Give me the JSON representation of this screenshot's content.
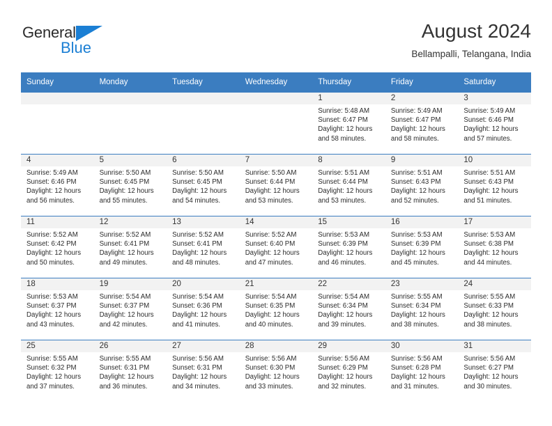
{
  "brand": {
    "line1": "General",
    "line2": "Blue",
    "triangle_color": "#1b7fd4",
    "text_color": "#2b2b2b"
  },
  "header": {
    "title": "August 2024",
    "subtitle": "Bellampalli, Telangana, India"
  },
  "theme": {
    "header_blue": "#3b7dc0",
    "band_gray": "#f2f2f2",
    "text": "#2b2b2b"
  },
  "weekdays": [
    "Sunday",
    "Monday",
    "Tuesday",
    "Wednesday",
    "Thursday",
    "Friday",
    "Saturday"
  ],
  "labels": {
    "sunrise": "Sunrise:",
    "sunset": "Sunset:",
    "daylight": "Daylight:"
  },
  "weeks": [
    [
      {
        "day": "",
        "sunrise": "",
        "sunset": "",
        "daylight_line1": "",
        "daylight_line2": ""
      },
      {
        "day": "",
        "sunrise": "",
        "sunset": "",
        "daylight_line1": "",
        "daylight_line2": ""
      },
      {
        "day": "",
        "sunrise": "",
        "sunset": "",
        "daylight_line1": "",
        "daylight_line2": ""
      },
      {
        "day": "",
        "sunrise": "",
        "sunset": "",
        "daylight_line1": "",
        "daylight_line2": ""
      },
      {
        "day": "1",
        "sunrise": "Sunrise: 5:48 AM",
        "sunset": "Sunset: 6:47 PM",
        "daylight_line1": "Daylight: 12 hours",
        "daylight_line2": "and 58 minutes."
      },
      {
        "day": "2",
        "sunrise": "Sunrise: 5:49 AM",
        "sunset": "Sunset: 6:47 PM",
        "daylight_line1": "Daylight: 12 hours",
        "daylight_line2": "and 58 minutes."
      },
      {
        "day": "3",
        "sunrise": "Sunrise: 5:49 AM",
        "sunset": "Sunset: 6:46 PM",
        "daylight_line1": "Daylight: 12 hours",
        "daylight_line2": "and 57 minutes."
      }
    ],
    [
      {
        "day": "4",
        "sunrise": "Sunrise: 5:49 AM",
        "sunset": "Sunset: 6:46 PM",
        "daylight_line1": "Daylight: 12 hours",
        "daylight_line2": "and 56 minutes."
      },
      {
        "day": "5",
        "sunrise": "Sunrise: 5:50 AM",
        "sunset": "Sunset: 6:45 PM",
        "daylight_line1": "Daylight: 12 hours",
        "daylight_line2": "and 55 minutes."
      },
      {
        "day": "6",
        "sunrise": "Sunrise: 5:50 AM",
        "sunset": "Sunset: 6:45 PM",
        "daylight_line1": "Daylight: 12 hours",
        "daylight_line2": "and 54 minutes."
      },
      {
        "day": "7",
        "sunrise": "Sunrise: 5:50 AM",
        "sunset": "Sunset: 6:44 PM",
        "daylight_line1": "Daylight: 12 hours",
        "daylight_line2": "and 53 minutes."
      },
      {
        "day": "8",
        "sunrise": "Sunrise: 5:51 AM",
        "sunset": "Sunset: 6:44 PM",
        "daylight_line1": "Daylight: 12 hours",
        "daylight_line2": "and 53 minutes."
      },
      {
        "day": "9",
        "sunrise": "Sunrise: 5:51 AM",
        "sunset": "Sunset: 6:43 PM",
        "daylight_line1": "Daylight: 12 hours",
        "daylight_line2": "and 52 minutes."
      },
      {
        "day": "10",
        "sunrise": "Sunrise: 5:51 AM",
        "sunset": "Sunset: 6:43 PM",
        "daylight_line1": "Daylight: 12 hours",
        "daylight_line2": "and 51 minutes."
      }
    ],
    [
      {
        "day": "11",
        "sunrise": "Sunrise: 5:52 AM",
        "sunset": "Sunset: 6:42 PM",
        "daylight_line1": "Daylight: 12 hours",
        "daylight_line2": "and 50 minutes."
      },
      {
        "day": "12",
        "sunrise": "Sunrise: 5:52 AM",
        "sunset": "Sunset: 6:41 PM",
        "daylight_line1": "Daylight: 12 hours",
        "daylight_line2": "and 49 minutes."
      },
      {
        "day": "13",
        "sunrise": "Sunrise: 5:52 AM",
        "sunset": "Sunset: 6:41 PM",
        "daylight_line1": "Daylight: 12 hours",
        "daylight_line2": "and 48 minutes."
      },
      {
        "day": "14",
        "sunrise": "Sunrise: 5:52 AM",
        "sunset": "Sunset: 6:40 PM",
        "daylight_line1": "Daylight: 12 hours",
        "daylight_line2": "and 47 minutes."
      },
      {
        "day": "15",
        "sunrise": "Sunrise: 5:53 AM",
        "sunset": "Sunset: 6:39 PM",
        "daylight_line1": "Daylight: 12 hours",
        "daylight_line2": "and 46 minutes."
      },
      {
        "day": "16",
        "sunrise": "Sunrise: 5:53 AM",
        "sunset": "Sunset: 6:39 PM",
        "daylight_line1": "Daylight: 12 hours",
        "daylight_line2": "and 45 minutes."
      },
      {
        "day": "17",
        "sunrise": "Sunrise: 5:53 AM",
        "sunset": "Sunset: 6:38 PM",
        "daylight_line1": "Daylight: 12 hours",
        "daylight_line2": "and 44 minutes."
      }
    ],
    [
      {
        "day": "18",
        "sunrise": "Sunrise: 5:53 AM",
        "sunset": "Sunset: 6:37 PM",
        "daylight_line1": "Daylight: 12 hours",
        "daylight_line2": "and 43 minutes."
      },
      {
        "day": "19",
        "sunrise": "Sunrise: 5:54 AM",
        "sunset": "Sunset: 6:37 PM",
        "daylight_line1": "Daylight: 12 hours",
        "daylight_line2": "and 42 minutes."
      },
      {
        "day": "20",
        "sunrise": "Sunrise: 5:54 AM",
        "sunset": "Sunset: 6:36 PM",
        "daylight_line1": "Daylight: 12 hours",
        "daylight_line2": "and 41 minutes."
      },
      {
        "day": "21",
        "sunrise": "Sunrise: 5:54 AM",
        "sunset": "Sunset: 6:35 PM",
        "daylight_line1": "Daylight: 12 hours",
        "daylight_line2": "and 40 minutes."
      },
      {
        "day": "22",
        "sunrise": "Sunrise: 5:54 AM",
        "sunset": "Sunset: 6:34 PM",
        "daylight_line1": "Daylight: 12 hours",
        "daylight_line2": "and 39 minutes."
      },
      {
        "day": "23",
        "sunrise": "Sunrise: 5:55 AM",
        "sunset": "Sunset: 6:34 PM",
        "daylight_line1": "Daylight: 12 hours",
        "daylight_line2": "and 38 minutes."
      },
      {
        "day": "24",
        "sunrise": "Sunrise: 5:55 AM",
        "sunset": "Sunset: 6:33 PM",
        "daylight_line1": "Daylight: 12 hours",
        "daylight_line2": "and 38 minutes."
      }
    ],
    [
      {
        "day": "25",
        "sunrise": "Sunrise: 5:55 AM",
        "sunset": "Sunset: 6:32 PM",
        "daylight_line1": "Daylight: 12 hours",
        "daylight_line2": "and 37 minutes."
      },
      {
        "day": "26",
        "sunrise": "Sunrise: 5:55 AM",
        "sunset": "Sunset: 6:31 PM",
        "daylight_line1": "Daylight: 12 hours",
        "daylight_line2": "and 36 minutes."
      },
      {
        "day": "27",
        "sunrise": "Sunrise: 5:56 AM",
        "sunset": "Sunset: 6:31 PM",
        "daylight_line1": "Daylight: 12 hours",
        "daylight_line2": "and 34 minutes."
      },
      {
        "day": "28",
        "sunrise": "Sunrise: 5:56 AM",
        "sunset": "Sunset: 6:30 PM",
        "daylight_line1": "Daylight: 12 hours",
        "daylight_line2": "and 33 minutes."
      },
      {
        "day": "29",
        "sunrise": "Sunrise: 5:56 AM",
        "sunset": "Sunset: 6:29 PM",
        "daylight_line1": "Daylight: 12 hours",
        "daylight_line2": "and 32 minutes."
      },
      {
        "day": "30",
        "sunrise": "Sunrise: 5:56 AM",
        "sunset": "Sunset: 6:28 PM",
        "daylight_line1": "Daylight: 12 hours",
        "daylight_line2": "and 31 minutes."
      },
      {
        "day": "31",
        "sunrise": "Sunrise: 5:56 AM",
        "sunset": "Sunset: 6:27 PM",
        "daylight_line1": "Daylight: 12 hours",
        "daylight_line2": "and 30 minutes."
      }
    ]
  ]
}
